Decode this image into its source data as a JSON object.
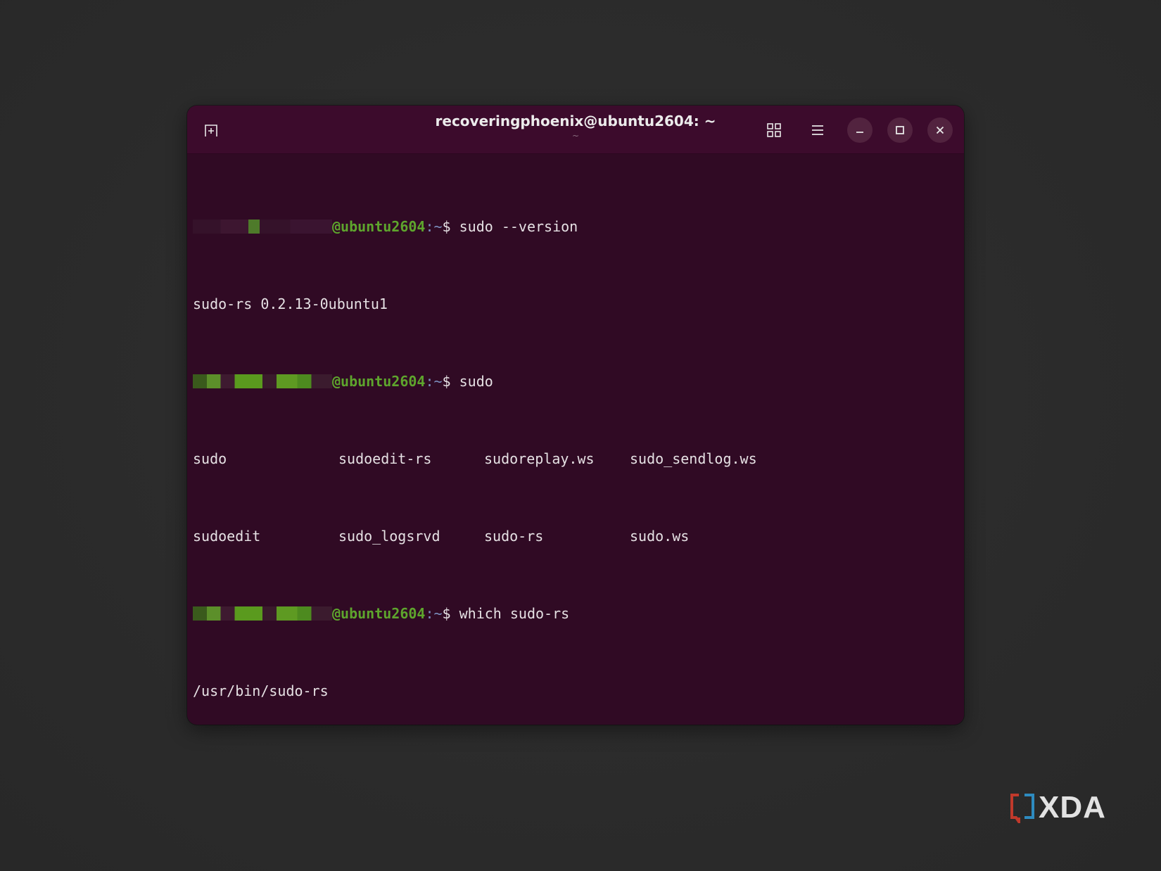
{
  "window": {
    "title": "recoveringphoenix@ubuntu2604: ~",
    "subtitle": "~"
  },
  "toolbar": {
    "new_tab_icon": "new-tab-icon",
    "view_icon": "grid-icon",
    "menu_icon": "hamburger-menu-icon",
    "minimize_icon": "minimize-icon",
    "maximize_icon": "maximize-icon",
    "close_icon": "close-icon"
  },
  "prompt": {
    "host": "@ubuntu2604",
    "path": ":~",
    "symbol": "$"
  },
  "terminal": {
    "cmd1": " sudo --version",
    "out1": "sudo-rs 0.2.13-0ubuntu1",
    "cmd2": " sudo",
    "completions_row1": [
      "sudo",
      "sudoedit-rs",
      "sudoreplay.ws",
      "sudo_sendlog.ws"
    ],
    "completions_row2": [
      "sudoedit",
      "sudo_logsrvd",
      "sudo-rs",
      "sudo.ws"
    ],
    "cmd3": " which sudo-rs",
    "out3": "/usr/bin/sudo-rs",
    "cmd4": " "
  },
  "watermark": {
    "brand": "XDA"
  },
  "colors": {
    "terminal_bg": "#300a24",
    "titlebar_bg": "#3c0b2c",
    "prompt_user": "#5ea52d",
    "prompt_path": "#7c8fbf",
    "text": "#e6e1e4"
  }
}
